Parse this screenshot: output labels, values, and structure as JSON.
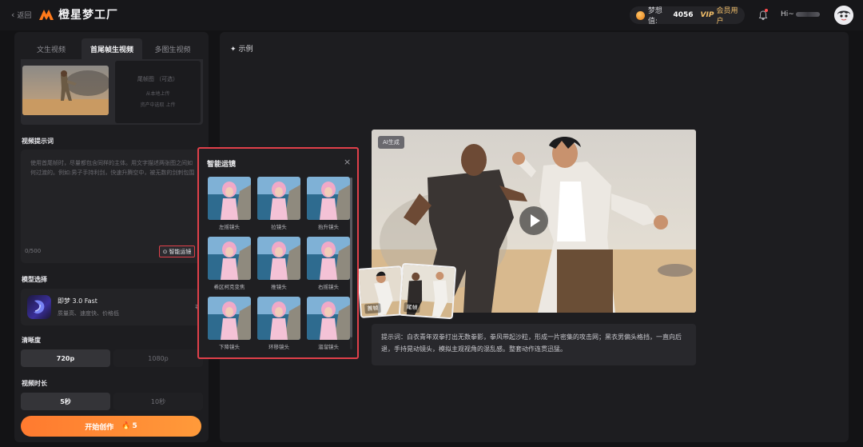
{
  "topbar": {
    "back_label": "返回",
    "logo_text": "橙星梦工厂",
    "points_label": "梦想值:",
    "points_value": "4056",
    "vip_mark": "VIP",
    "vip_text": "会员用户",
    "greeting": "Hi~"
  },
  "tabs": [
    {
      "label": "文生视频",
      "active": false
    },
    {
      "label": "首尾帧生视频",
      "active": true
    },
    {
      "label": "多图生视频",
      "active": false
    }
  ],
  "end_frame": {
    "title": "尾帧图 （可选）",
    "upload": "从本地上传",
    "pick": "资产中选取 上传"
  },
  "prompt": {
    "label": "视频提示词",
    "placeholder": "使用首尾帧时，尽量都包含同样的主体。用文字描述两张图之间如何过渡的。例如:男子手持利剑，快速升腾空中，被无数的剑刺包围",
    "counter": "0/500",
    "smart_button": "智能运镜"
  },
  "model": {
    "label": "模型选择",
    "name": "即梦 3.0 Fast",
    "desc": "质量高、速度快、价格低"
  },
  "resolution": {
    "label": "清晰度",
    "options": [
      "720p",
      "1080p"
    ],
    "selected": "720p"
  },
  "duration": {
    "label": "视频时长",
    "options": [
      "5秒",
      "10秒"
    ],
    "selected": "5秒"
  },
  "start": {
    "label": "开始创作",
    "cost": "5"
  },
  "example": {
    "title": "示例",
    "badge": "AI生成",
    "thumb_first": "首帧",
    "thumb_last": "尾帧",
    "caption": "提示词：白衣青年双拳打出无数拳影，拳风带起沙粒，形成一片密集的攻击网；黑衣男偏头格挡，一直向后退，手持晃动镜头，模拟主观视角的混乱感。整套动作连贯迅猛。"
  },
  "popup": {
    "title": "智能运镜",
    "items": [
      "左摇镜头",
      "拉镜头",
      "抬升镜头",
      "希区柯克变焦",
      "推镜头",
      "右摇镜头",
      "下降镜头",
      "环移镜头",
      "溜溜镜头"
    ]
  },
  "colors": {
    "accent": "#ff8a35",
    "highlight_border": "#e0404a",
    "vip_gold": "#f4c06a"
  }
}
